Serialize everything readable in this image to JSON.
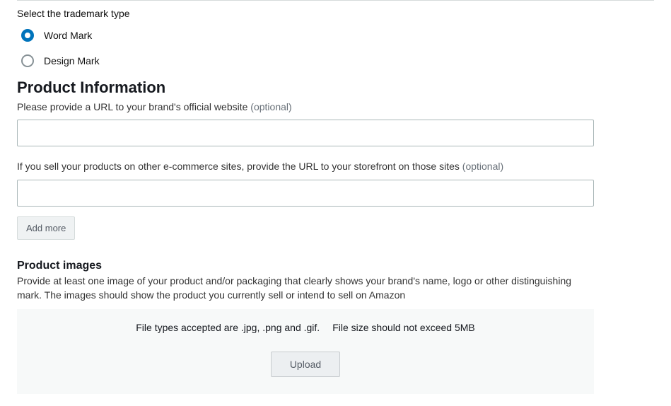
{
  "trademark": {
    "select_label": "Select the trademark type",
    "options": {
      "word": "Word Mark",
      "design": "Design Mark"
    }
  },
  "product_info": {
    "title": "Product Information",
    "website_label": "Please provide a URL to your brand's official website",
    "website_optional": "(optional)",
    "storefront_label": "If you sell your products on other e-commerce sites, provide the URL to your storefront on those sites",
    "storefront_optional": "(optional)",
    "add_more": "Add more"
  },
  "product_images": {
    "heading": "Product images",
    "description": "Provide at least one image of your product and/or packaging that clearly shows your brand's name, logo or other distinguishing mark. The images should show the product you currently sell or intend to sell on Amazon",
    "hint_types": "File types accepted are .jpg, .png and .gif.",
    "hint_size": "File size should not exceed 5MB",
    "upload": "Upload"
  }
}
